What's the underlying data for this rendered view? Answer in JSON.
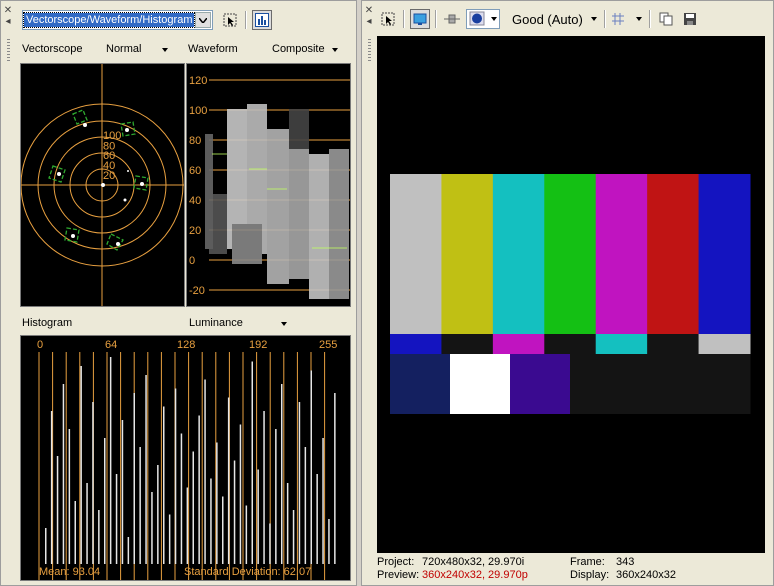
{
  "left": {
    "scope_selector": "Vectorscope/Waveform/Histogram",
    "vectorscope": {
      "title": "Vectorscope",
      "mode": "Normal",
      "ring_labels": [
        "100",
        "80",
        "60",
        "40",
        "20"
      ]
    },
    "waveform": {
      "title": "Waveform",
      "mode": "Composite",
      "ire_labels": [
        "120",
        "100",
        "80",
        "60",
        "40",
        "20",
        "0",
        "-20"
      ]
    },
    "histogram": {
      "title": "Histogram",
      "mode": "Luminance",
      "x_labels": [
        "0",
        "64",
        "128",
        "192",
        "255"
      ],
      "mean": "Mean: 93.04",
      "stddev": "Standard Deviation: 62.07"
    }
  },
  "right": {
    "quality": "Good (Auto)",
    "status": {
      "project_label": "Project:",
      "project_value": "720x480x32, 29.970i",
      "frame_label": "Frame:",
      "frame_value": "343",
      "preview_label": "Preview:",
      "preview_value": "360x240x32, 29.970p",
      "display_label": "Display:",
      "display_value": "360x240x32"
    }
  },
  "colors": {
    "scope_lines": "#e8a040",
    "bars_top": [
      "#c0c0c0",
      "#c0c014",
      "#14c0c0",
      "#14c014",
      "#c014c0",
      "#c01414",
      "#1414c0"
    ],
    "bars_mid": [
      "#1414c0",
      "#141414",
      "#c014c0",
      "#141414",
      "#14c0c0",
      "#141414",
      "#c0c0c0"
    ],
    "bars_bottom": [
      "#142060",
      "#ffffff",
      "#3a0a90",
      "#141414",
      "#141414"
    ]
  },
  "icons": [
    "close-icon",
    "pin-icon",
    "select-icon",
    "histogram-view-icon",
    "monitor-icon",
    "split-icon",
    "overlay-icon",
    "grid-icon",
    "copy-icon",
    "save-icon"
  ]
}
